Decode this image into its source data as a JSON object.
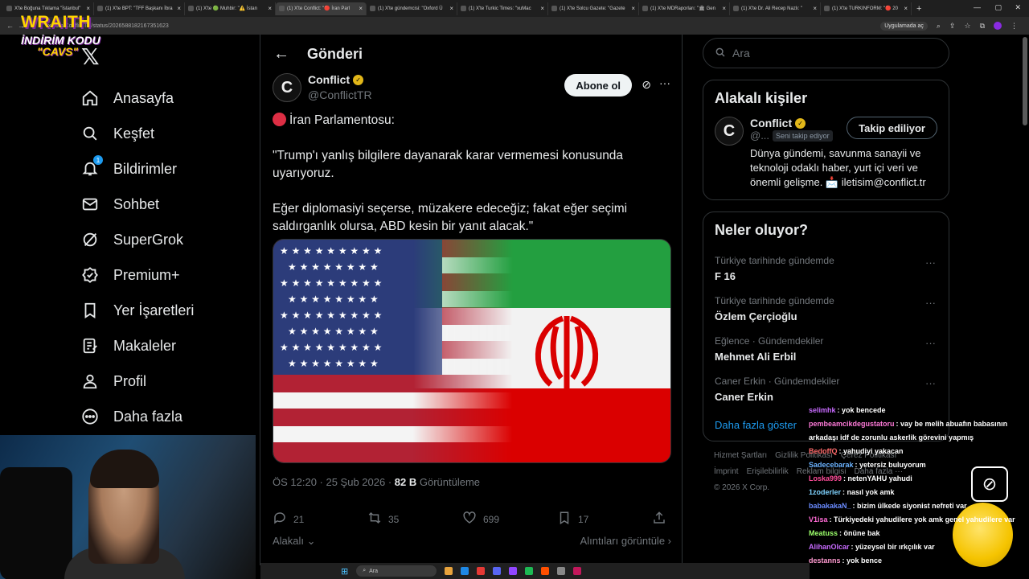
{
  "browser": {
    "tabs": [
      {
        "title": "X'te Boğuna Tıklama \"İstanbul\"",
        "active": false
      },
      {
        "title": "(1) X'te BPT: \"TFF Başkanı İbra",
        "active": false
      },
      {
        "title": "(1) X'te 🟢 Muhbir: \"⚠️ İstan",
        "active": false
      },
      {
        "title": "(1) X'te Conflict: \"🔴 İran Parl",
        "active": true
      },
      {
        "title": "(1) X'te gündemcisi: \"Oxford Ü",
        "active": false
      },
      {
        "title": "(1) X'te Turkic Times: \"xuMac",
        "active": false
      },
      {
        "title": "(1) X'te Solcu Gazete: \"Gazete",
        "active": false
      },
      {
        "title": "(1) X'te MDRaporları: \"🏛 Gen",
        "active": false
      },
      {
        "title": "(1) X'te Dr. Ali Recep Nazlı: \"",
        "active": false
      },
      {
        "title": "(1) X'te TURKINFORM: \"🔴 20",
        "active": false
      }
    ],
    "new_tab": "+",
    "url": "x.com/ConflictTR/status/2026588182167351623",
    "open_in_app": "Uygulamada aç"
  },
  "overlay": {
    "brand": "WRAITH",
    "line2": "İNDİRİM KODU",
    "code": "\"CAVS\""
  },
  "nav": {
    "logo": "𝕏",
    "items": [
      {
        "label": "Anasayfa",
        "icon": "home-icon"
      },
      {
        "label": "Keşfet",
        "icon": "search-icon"
      },
      {
        "label": "Bildirimler",
        "icon": "bell-icon",
        "badge": "1"
      },
      {
        "label": "Sohbet",
        "icon": "mail-icon"
      },
      {
        "label": "SuperGrok",
        "icon": "grok-icon"
      },
      {
        "label": "Premium+",
        "icon": "verified-badge-icon"
      },
      {
        "label": "Yer İşaretleri",
        "icon": "bookmark-icon"
      },
      {
        "label": "Makaleler",
        "icon": "article-icon"
      },
      {
        "label": "Profil",
        "icon": "person-icon"
      },
      {
        "label": "Daha fazla",
        "icon": "more-circle-icon"
      }
    ]
  },
  "post": {
    "header_title": "Gönderi",
    "author_name": "Conflict",
    "author_handle": "@ConflictTR",
    "avatar_letter": "C",
    "subscribe_label": "Abone ol",
    "lines": [
      "İran Parlamentosu:",
      "\"Trump'ı yanlış bilgilere dayanarak karar vermemesi konusunda uyarıyoruz.",
      "Eğer diplomasiyi seçerse, müzakere edeceğiz; fakat eğer seçimi saldırganlık olursa, ABD kesin bir yanıt alacak.\""
    ],
    "timestamp": "ÖS 12:20 · 25 Şub 2026 · ",
    "views_count": "82 B",
    "views_label": " Görüntüleme",
    "replies": "21",
    "reposts": "35",
    "likes": "699",
    "bookmarks": "17",
    "related_left": "Alakalı ⌄",
    "related_right": "Alıntıları görüntüle ›"
  },
  "sidebar": {
    "search_placeholder": "Ara",
    "related_title": "Alakalı kişiler",
    "related_person": {
      "name": "Conflict",
      "handle": "@...",
      "follows_you": "Seni takip ediyor",
      "follow_button": "Takip ediliyor",
      "bio": "Dünya gündemi, savunma sanayii ve teknoloji odaklı haber, yurt içi veri ve önemli gelişme. 📩 iletisim@conflict.tr"
    },
    "trends_title": "Neler oluyor?",
    "trends": [
      {
        "context": "Türkiye tarihinde gündemde",
        "topic": "F 16"
      },
      {
        "context": "Türkiye tarihinde gündemde",
        "topic": "Özlem Çerçioğlu"
      },
      {
        "context": "Eğlence · Gündemdekiler",
        "topic": "Mehmet Ali Erbil"
      },
      {
        "context": "Caner Erkin · Gündemdekiler",
        "topic": "Caner Erkin"
      }
    ],
    "show_more": "Daha fazla göster",
    "footer_row1": [
      "Hizmet Şartları",
      "Gizlilik Politikası",
      "Çerez Politikası"
    ],
    "footer_row2": [
      "İmprint",
      "Erişilebilirlik",
      "Reklam bilgisi",
      "Daha fazla ···"
    ],
    "copyright": "© 2026 X Corp."
  },
  "taskbar": {
    "search": "Ara"
  },
  "chat": [
    {
      "user": "selimhk",
      "text": "yok bencede",
      "color": "#c86bff"
    },
    {
      "user": "pembeamcikdegustatoru",
      "text": "vay be melih abuafın babasının arkadaşı idf de zorunlu askerlik görevini yapmış",
      "color": "#ff7ad9"
    },
    {
      "user": "BedoffQ",
      "text": "yahudiyi yakacan",
      "color": "#ff6b6b"
    },
    {
      "user": "Sadecebarak",
      "text": "yetersiz buluyorum",
      "color": "#6bb3ff"
    },
    {
      "user": "Loska999",
      "text": "netenYAHU yahudi",
      "color": "#ff4d9a"
    },
    {
      "user": "1zoderler",
      "text": "nasıl yok amk",
      "color": "#7fd3ff"
    },
    {
      "user": "babakakaN_",
      "text": "bizim ülkede siyonist nefreti var",
      "color": "#6a8bff"
    },
    {
      "user": "V1isa",
      "text": "Türkiyedeki yahudilere yok amk genel yahudilere var",
      "color": "#ff6bd5"
    },
    {
      "user": "Meatuss",
      "text": "önüne bak",
      "color": "#9cff6b"
    },
    {
      "user": "AlihanOlcar",
      "text": "yüzeysel bir ırkçılık var",
      "color": "#c86bff"
    },
    {
      "user": "destanns",
      "text": "yok bence",
      "color": "#ff9ad0"
    }
  ]
}
